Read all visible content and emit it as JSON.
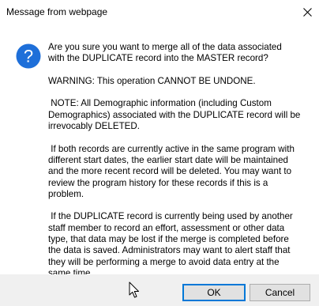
{
  "window": {
    "title": "Message from webpage",
    "close_icon": "close-icon"
  },
  "dialog": {
    "icon": "question-icon",
    "paragraphs": [
      "Are you sure you want to merge all of the data associated\nwith the DUPLICATE record into the MASTER record?",
      "WARNING: This operation CANNOT BE UNDONE.",
      " NOTE: All Demographic information (including Custom\nDemographics) associated with the DUPLICATE record will be\nirrevocably DELETED.",
      " If both records are currently active in the same program with\ndifferent start dates, the earlier start date will be maintained\nand the more recent record will be deleted. You may want to\nreview the program history for these records if this is a\nproblem.",
      " If the DUPLICATE record is currently being used by another\nstaff member to record an effort, assessment or other data\ntype, that data may be lost if the merge is completed before\nthe data is saved. Administrators may want to alert staff that\nthey will be performing a merge to avoid data entry at the\nsame time."
    ]
  },
  "buttons": {
    "ok_label": "OK",
    "cancel_label": "Cancel"
  },
  "colors": {
    "icon_blue": "#1e6fd9",
    "focus_border": "#0078d7",
    "footer_bg": "#f0f0f0"
  }
}
